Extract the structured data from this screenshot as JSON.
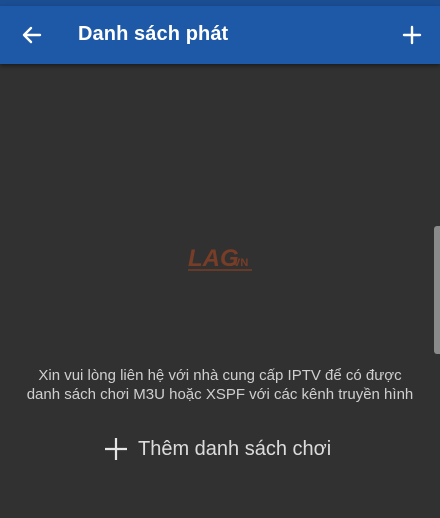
{
  "appbar": {
    "title": "Danh sách phát",
    "back_icon": "arrow-left-icon",
    "add_icon": "plus-icon",
    "background": "#1e59a8"
  },
  "main": {
    "background": "#313131",
    "watermark": "LAG.VN",
    "hint_line1": "Xin vui lòng liên hệ với nhà cung cấp IPTV để có được",
    "hint_line2": "danh sách chơi M3U hoặc XSPF với các kênh truyền hình",
    "add_playlist_label": "Thêm danh sách chơi",
    "add_playlist_icon": "plus-icon"
  }
}
